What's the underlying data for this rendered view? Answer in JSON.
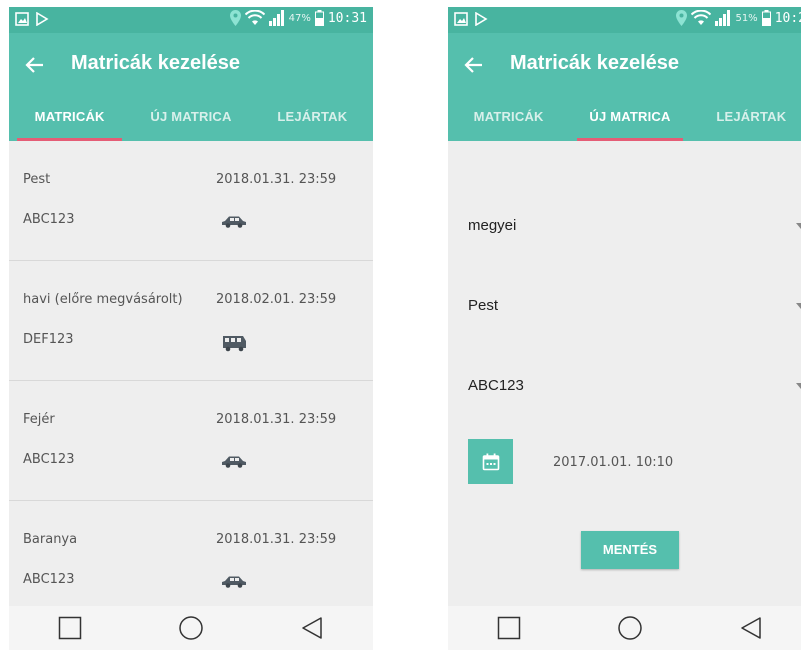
{
  "left": {
    "status": {
      "battery_pct": "47%",
      "time": "10:31"
    },
    "title": "Matricák kezelése",
    "tabs": [
      "MATRICÁK",
      "ÚJ MATRICA",
      "LEJÁRTAK"
    ],
    "active_tab": 0,
    "items": [
      {
        "name": "Pest",
        "date": "2018.01.31. 23:59",
        "plate": "ABC123",
        "vehicle": "car-icon"
      },
      {
        "name": "havi (előre megvásárolt)",
        "date": "2018.02.01. 23:59",
        "plate": "DEF123",
        "vehicle": "bus-icon"
      },
      {
        "name": "Fejér",
        "date": "2018.01.31. 23:59",
        "plate": "ABC123",
        "vehicle": "car-icon"
      },
      {
        "name": "Baranya",
        "date": "2018.01.31. 23:59",
        "plate": "ABC123",
        "vehicle": "car-icon"
      }
    ]
  },
  "right": {
    "status": {
      "battery_pct": "51%",
      "time": "10:2"
    },
    "title": "Matricák kezelése",
    "tabs": [
      "MATRICÁK",
      "ÚJ MATRICA",
      "LEJÁRTAK"
    ],
    "active_tab": 1,
    "form": {
      "type_value": "megyei",
      "county_value": "Pest",
      "plate_value": "ABC123",
      "datetime": "2017.01.01. 10:10",
      "save_label": "MENTÉS"
    }
  },
  "colors": {
    "status_bar": "#48b4a0",
    "toolbar": "#55bfad",
    "tab_indicator": "#e45d76",
    "background": "#eeeeee"
  }
}
